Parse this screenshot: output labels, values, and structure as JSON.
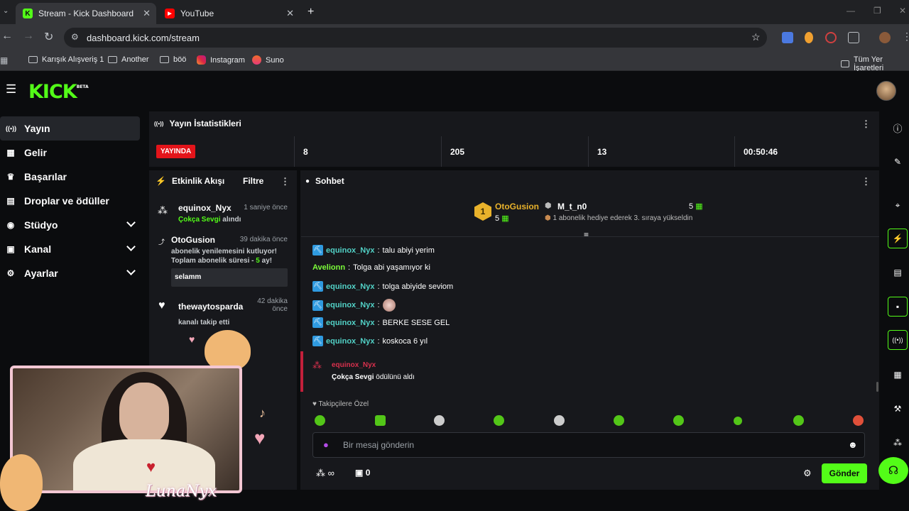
{
  "browser": {
    "tabs": [
      {
        "title": "Stream - Kick Dashboard",
        "fav": "K",
        "fav_color": "#53fc18"
      },
      {
        "title": "YouTube",
        "fav": "▶",
        "fav_color": "#ff0000"
      }
    ],
    "url": "dashboard.kick.com/stream",
    "bookmarks": [
      "Karışık Alışveriş 1",
      "Another",
      "böö",
      "Instagram",
      "Suno"
    ],
    "bookmarks_right": "Tüm Yer İşaretleri"
  },
  "app": {
    "logo": "KICK",
    "logo_badge": "BETA",
    "accent_color": "#53fc18"
  },
  "sidebar": {
    "items": [
      {
        "label": "Yayın",
        "icon": "broadcast-icon",
        "glyph": "((•))"
      },
      {
        "label": "Gelir",
        "icon": "revenue-icon",
        "glyph": "▦"
      },
      {
        "label": "Başarılar",
        "icon": "trophy-icon",
        "glyph": "🏆"
      },
      {
        "label": "Droplar ve ödüller",
        "icon": "gift-icon",
        "glyph": "▤"
      },
      {
        "label": "Stüdyo",
        "icon": "studio-icon",
        "glyph": "◉"
      },
      {
        "label": "Kanal",
        "icon": "channel-icon",
        "glyph": "▣"
      },
      {
        "label": "Ayarlar",
        "icon": "gear-icon",
        "glyph": "⚙"
      }
    ]
  },
  "stats": {
    "title": "Yayın İstatistikleri",
    "live_label": "YAYINDA",
    "values": [
      "8",
      "205",
      "13",
      "00:50:46"
    ]
  },
  "activity": {
    "title": "Etkinlik Akışı",
    "filter_label": "Filtre",
    "events": [
      {
        "name": "equinox_Nyx",
        "time": "1 saniye önce",
        "line1_highlight": "Çokça Sevgi",
        "line1_rest": " alındı"
      },
      {
        "name": "OtoGusion",
        "time": "39 dakika önce",
        "line1": "abonelik yenilemesini kutluyor!",
        "line2_a": "Toplam abonelik süresi - ",
        "line2_num": "5",
        "line2_b": " ay!",
        "message": "selamm"
      },
      {
        "name": "thewaytosparda",
        "time": "42 dakika önce",
        "line1": "kanalı takip etti"
      }
    ]
  },
  "chat": {
    "title": "Sohbet",
    "pinned": {
      "rank": "1",
      "user1": "OtoGusion",
      "user1_count": "5",
      "user2": "M_t_n0",
      "user2_count": "5",
      "note": "1 abonelik hediye ederek 3. sıraya yükseldin"
    },
    "messages": [
      {
        "user": "equinox_Nyx",
        "text": "talu abiyi yerim",
        "badge": true,
        "color": "teal"
      },
      {
        "user": "Avelionn",
        "text": "Tolga abi yaşamıyor ki",
        "badge": false,
        "color": "lime"
      },
      {
        "user": "equinox_Nyx",
        "text": "tolga abiyide seviom",
        "badge": true,
        "color": "teal"
      },
      {
        "user": "equinox_Nyx",
        "text": "",
        "badge": true,
        "color": "teal"
      },
      {
        "user": "equinox_Nyx",
        "text": "BERKE SESE GEL",
        "badge": true,
        "color": "teal"
      },
      {
        "user": "equinox_Nyx",
        "text": "koskoca 6 yıl",
        "badge": true,
        "color": "teal"
      }
    ],
    "reward": {
      "user": "equinox_Nyx",
      "reward_name": "Çokça Sevgi",
      "rest": " ödülünü aldı"
    },
    "emote_section": "Takipçilere Özel",
    "input_placeholder": "Bir mesaj gönderin",
    "points": "∞",
    "store_count": "0",
    "send_label": "Gönder"
  },
  "overlay": {
    "tag": "LunaNyx"
  }
}
